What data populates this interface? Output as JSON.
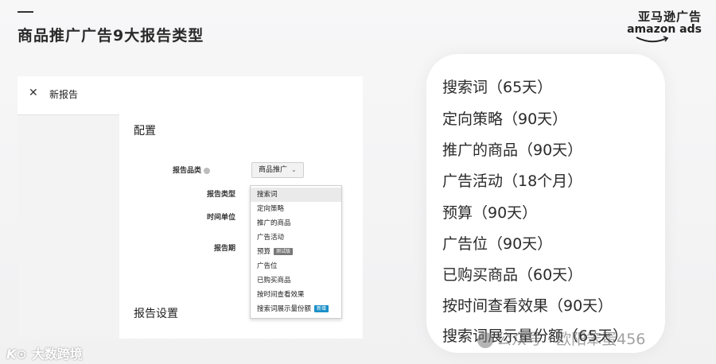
{
  "slide": {
    "title": "商品推广广告9大报告类型"
  },
  "brand": {
    "cn": "亚马逊广告",
    "en": "amazon ads"
  },
  "panel": {
    "header_label": "新报告",
    "close_icon": "close-icon",
    "config_title": "配置",
    "settings_title": "报告设置",
    "fields": {
      "category_label": "报告品类",
      "type_label": "报告类型",
      "time_unit_label": "时间单位",
      "period_label": "报告期"
    },
    "category_value": "商品推广",
    "dropdown_options": [
      {
        "label": "搜索词",
        "tag": ""
      },
      {
        "label": "定向策略",
        "tag": ""
      },
      {
        "label": "推广的商品",
        "tag": ""
      },
      {
        "label": "广告活动",
        "tag": ""
      },
      {
        "label": "预算",
        "tag": "测试版"
      },
      {
        "label": "广告位",
        "tag": ""
      },
      {
        "label": "已购买商品",
        "tag": ""
      },
      {
        "label": "按时间查看效果",
        "tag": ""
      },
      {
        "label": "搜索词展示量份额",
        "tag": "新增"
      }
    ],
    "selected_option_index": 0
  },
  "report_list": [
    "搜索词（65天）",
    "定向策略（90天）",
    "推广的商品（90天）",
    "广告活动（18个月）",
    "预算（90天）",
    "广告位（90天）",
    "已购买商品（60天）",
    "按时间查看效果（90天）",
    "搜索词展示量份额（65天）"
  ],
  "footer": {
    "logo_prefix": "K⊙",
    "logo_text": "大数跨境",
    "watermark": "公众号 · 欧阳笨蛋456"
  },
  "colors": {
    "accent_blue": "#1a8fc9",
    "beta_gray": "#777777"
  }
}
